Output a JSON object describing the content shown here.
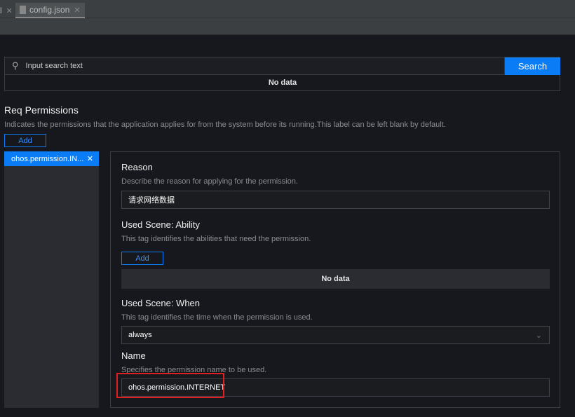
{
  "tabs": [
    {
      "label": "l"
    },
    {
      "label": "config.json",
      "active": true
    }
  ],
  "search": {
    "placeholder": "Input search text",
    "button": "Search",
    "empty": "No data"
  },
  "section": {
    "title": "Req Permissions",
    "description": "Indicates the permissions that the application applies for from the system before its running.This label can be left blank by default.",
    "add": "Add"
  },
  "permissions": [
    {
      "label": "ohos.permission.IN..."
    }
  ],
  "detail": {
    "reason": {
      "label": "Reason",
      "description": "Describe the reason for applying for the permission.",
      "value": "请求网络数据"
    },
    "ability": {
      "label": "Used Scene: Ability",
      "description": "This tag identifies the abilities that need the permission.",
      "add": "Add",
      "empty": "No data"
    },
    "when": {
      "label": "Used Scene: When",
      "description": "This tag identifies the time when the permission is used.",
      "value": "always"
    },
    "name": {
      "label": "Name",
      "description": "Specifies the permission name to be used.",
      "value": "ohos.permission.INTERNET"
    }
  },
  "colors": {
    "accent": "#0a7cf5",
    "highlight": "#e02020"
  }
}
